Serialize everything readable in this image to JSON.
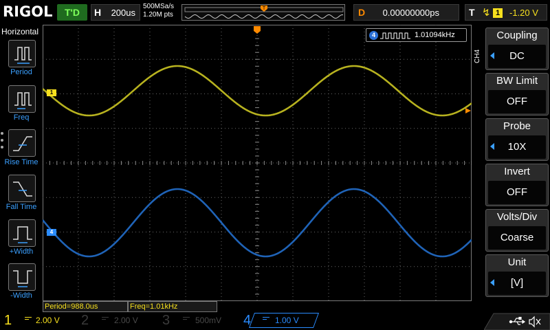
{
  "brand": "RIGOL",
  "status": "T'D",
  "timebase": {
    "label": "H",
    "value": "200us"
  },
  "sample_rate": "500MSa/s",
  "memory_depth": "1.20M pts",
  "delay": {
    "label": "D",
    "value": "0.00000000ps"
  },
  "trigger": {
    "label": "T",
    "source": "1",
    "level": "-1.20 V"
  },
  "left_menu": {
    "title": "Horizontal",
    "items": [
      {
        "label": "Period",
        "icon": "period-icon"
      },
      {
        "label": "Freq",
        "icon": "freq-icon"
      },
      {
        "label": "Rise Time",
        "icon": "rise-time-icon"
      },
      {
        "label": "Fall Time",
        "icon": "fall-time-icon"
      },
      {
        "label": "+Width",
        "icon": "positive-width-icon"
      },
      {
        "label": "-Width",
        "icon": "negative-width-icon"
      }
    ]
  },
  "frequency_counter": {
    "channel": "4",
    "value": "1.01094kHz"
  },
  "channel_markers": {
    "ch1": "1",
    "ch4": "4"
  },
  "right_menu": {
    "channel": "CH4",
    "items": [
      {
        "label": "Coupling",
        "value": "DC",
        "arrow": true
      },
      {
        "label": "BW Limit",
        "value": "OFF",
        "arrow": false
      },
      {
        "label": "Probe",
        "value": "10X",
        "arrow": true
      },
      {
        "label": "Invert",
        "value": "OFF",
        "arrow": false
      },
      {
        "label": "Volts/Div",
        "value": "Coarse",
        "arrow": false
      },
      {
        "label": "Unit",
        "value": "[V]",
        "arrow": true
      }
    ]
  },
  "measurements": [
    {
      "text": "Period=988.0us"
    },
    {
      "text": "Freq=1.01kHz"
    }
  ],
  "channels": [
    {
      "num": "1",
      "scale": "2.00 V",
      "color": "#f7e01e",
      "active": false,
      "enabled": true
    },
    {
      "num": "2",
      "scale": "2.00 V",
      "color": "#00c8c8",
      "active": false,
      "enabled": false
    },
    {
      "num": "3",
      "scale": "500mV",
      "color": "#e040e0",
      "active": false,
      "enabled": false
    },
    {
      "num": "4",
      "scale": "1.00 V",
      "color": "#2a8cff",
      "active": true,
      "enabled": true
    }
  ],
  "colors": {
    "ch1_trace": "#b7b21f",
    "ch4_trace": "#1f63b7",
    "trigger": "#ff8a00",
    "grid": "#6a6a6a"
  }
}
